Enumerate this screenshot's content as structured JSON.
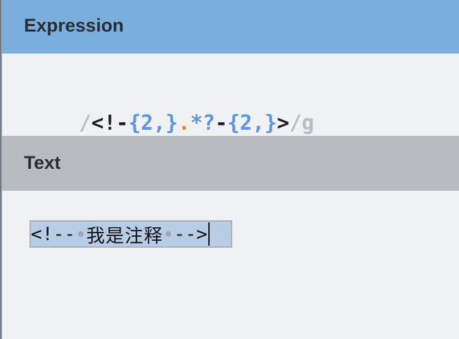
{
  "expression_section": {
    "title": "Expression",
    "tokens": {
      "open_delim": "/",
      "lit_start": "<!-",
      "quant_1": "{2,}",
      "dot": ".",
      "lazy_star": "*?",
      "lit_dash": "-",
      "quant_2": "{2,}",
      "lit_end": ">",
      "close_delim": "/",
      "flags": "g"
    }
  },
  "text_section": {
    "title": "Text",
    "content": {
      "part_1": "<!--",
      "part_2": "我是注释",
      "part_3": "-->"
    }
  },
  "colors": {
    "expression_header": "#7aaedf",
    "text_header": "#b8bbbf",
    "quantifier": "#5c94e8",
    "dot_token": "#d8844a",
    "match_highlight": "#b7cde5"
  },
  "icons": {
    "whitespace_marker": "middle-dot",
    "end_of_line_marker": "eol-corner"
  }
}
